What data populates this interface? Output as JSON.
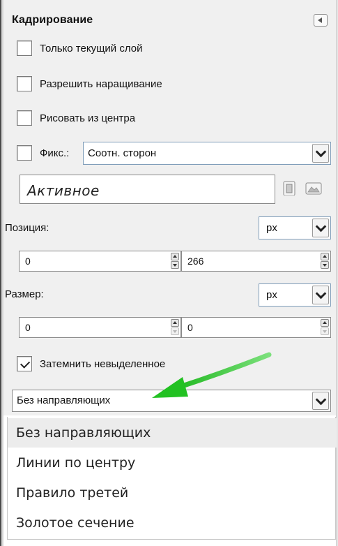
{
  "panel": {
    "title": "Кадрирование",
    "options": {
      "current_layer_only": "Только текущий слой",
      "allow_growing": "Разрешить наращивание",
      "expand_from_center": "Рисовать из центра",
      "fixed_label": "Фикс.:",
      "fixed_mode": "Соотн. сторон",
      "fixed_value": "Активное",
      "highlight": "Затемнить невыделенное"
    },
    "position": {
      "label": "Позиция:",
      "unit": "px",
      "x": "0",
      "y": "266"
    },
    "size": {
      "label": "Размер:",
      "unit": "px",
      "w": "0",
      "h": "0"
    },
    "guides": {
      "selected": "Без направляющих",
      "options": [
        "Без направляющих",
        "Линии по центру",
        "Правило третей",
        "Золотое сечение"
      ]
    }
  },
  "colors": {
    "panel_bg": "#f0f0f0",
    "annotation_arrow": "#2ecc2e"
  }
}
